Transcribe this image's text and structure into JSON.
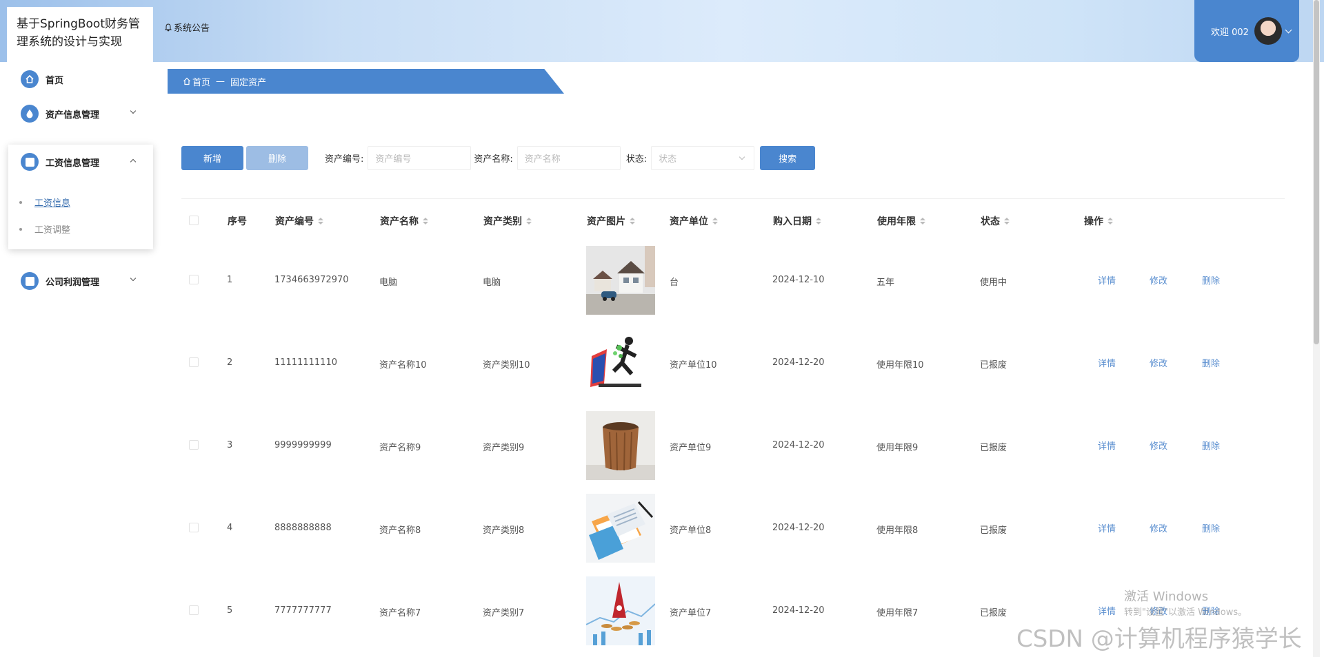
{
  "header": {
    "app_title": "基于SpringBoot财务管理系统的设计与实现",
    "notice_label": "系统公告",
    "welcome_text": "欢迎 002"
  },
  "sidebar": {
    "items": [
      {
        "label": "首页"
      },
      {
        "label": "资产信息管理"
      },
      {
        "label": "工资信息管理"
      },
      {
        "label": "公司利润管理"
      }
    ],
    "submenu": [
      {
        "label": "工资信息"
      },
      {
        "label": "工资调整"
      }
    ]
  },
  "breadcrumb": {
    "home": "首页",
    "separator": "—",
    "current": "固定资产"
  },
  "toolbar": {
    "add_label": "新增",
    "delete_label": "删除",
    "asset_no_label": "资产编号:",
    "asset_no_placeholder": "资产编号",
    "asset_name_label": "资产名称:",
    "asset_name_placeholder": "资产名称",
    "status_label": "状态:",
    "status_placeholder": "状态",
    "search_label": "搜索"
  },
  "table": {
    "headers": [
      "序号",
      "资产编号",
      "资产名称",
      "资产类别",
      "资产图片",
      "资产单位",
      "购入日期",
      "使用年限",
      "状态",
      "操作"
    ],
    "rows": [
      {
        "idx": "1",
        "no": "1734663972970",
        "name": "电脑",
        "category": "电脑",
        "unit": "台",
        "date": "2024-12-10",
        "years": "五年",
        "status": "使用中"
      },
      {
        "idx": "2",
        "no": "11111111110",
        "name": "资产名称10",
        "category": "资产类别10",
        "unit": "资产单位10",
        "date": "2024-12-20",
        "years": "使用年限10",
        "status": "已报废"
      },
      {
        "idx": "3",
        "no": "9999999999",
        "name": "资产名称9",
        "category": "资产类别9",
        "unit": "资产单位9",
        "date": "2024-12-20",
        "years": "使用年限9",
        "status": "已报废"
      },
      {
        "idx": "4",
        "no": "8888888888",
        "name": "资产名称8",
        "category": "资产类别8",
        "unit": "资产单位8",
        "date": "2024-12-20",
        "years": "使用年限8",
        "status": "已报废"
      },
      {
        "idx": "5",
        "no": "7777777777",
        "name": "资产名称7",
        "category": "资产类别7",
        "unit": "资产单位7",
        "date": "2024-12-20",
        "years": "使用年限7",
        "status": "已报废"
      }
    ],
    "ops": {
      "detail": "详情",
      "edit": "修改",
      "delete": "删除"
    }
  },
  "watermarks": {
    "windows_line1": "激活 Windows",
    "windows_line2": "转到\"设置\"以激活 Windows。",
    "csdn": "CSDN @计算机程序猿学长"
  },
  "colors": {
    "primary": "#4a86cf",
    "link": "#5b8fd0"
  }
}
